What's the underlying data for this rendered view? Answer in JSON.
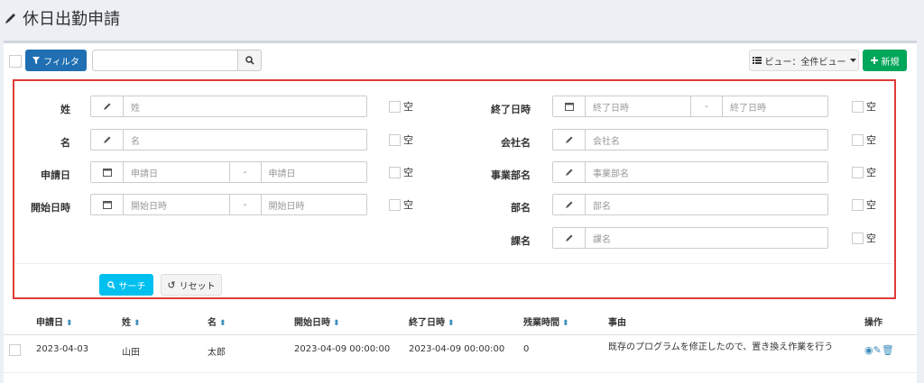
{
  "page": {
    "title": "休日出勤申請"
  },
  "toolbar": {
    "filter_label": "フィルタ",
    "view_label": "ビュー：全件ビュー",
    "new_label": "新規",
    "search_value": ""
  },
  "filter": {
    "empty_label": "空",
    "dash": "-",
    "fields": {
      "sei": {
        "label": "姓",
        "placeholder": "姓"
      },
      "mei": {
        "label": "名",
        "placeholder": "名"
      },
      "apply_date": {
        "label": "申請日",
        "from": "申請日",
        "to": "申請日"
      },
      "start": {
        "label": "開始日時",
        "from": "開始日時",
        "to": "開始日時"
      },
      "end": {
        "label": "終了日時",
        "from": "終了日時",
        "to": "終了日時"
      },
      "company": {
        "label": "会社名",
        "placeholder": "会社名"
      },
      "division": {
        "label": "事業部名",
        "placeholder": "事業部名"
      },
      "dept": {
        "label": "部名",
        "placeholder": "部名"
      },
      "section": {
        "label": "課名",
        "placeholder": "課名"
      }
    },
    "search_label": "サーチ",
    "reset_label": "リセット"
  },
  "table": {
    "columns": [
      "申請日",
      "姓",
      "名",
      "開始日時",
      "終了日時",
      "残業時間",
      "事由",
      "操作"
    ],
    "rows": [
      {
        "date": "2023-04-03",
        "sei": "山田",
        "mei": "太郎",
        "start": "2023-04-09 00:00:00",
        "end": "2023-04-09 00:00:00",
        "hours": "0",
        "reason": "既存のプログラムを修正したので、置き換え作業を行う"
      }
    ]
  },
  "colors": {
    "filter_btn": "#1f6fb2",
    "new_btn": "#00a65a",
    "search_btn": "#00c0ef",
    "border_red": "#e03a3a",
    "sort_icon": "#3c8dbc"
  }
}
